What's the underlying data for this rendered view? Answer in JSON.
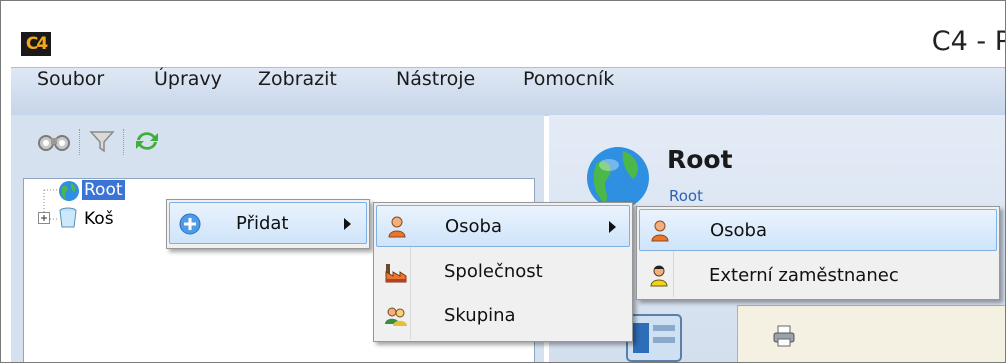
{
  "window": {
    "app_logo": "C4",
    "title": "C4 - P"
  },
  "menubar": [
    "Soubor",
    "Úpravy",
    "Zobrazit",
    "Nástroje",
    "Pomocník"
  ],
  "toolbar": {
    "icons": [
      "binoculars-icon",
      "filter-icon",
      "refresh-icon"
    ]
  },
  "tree": {
    "root": "Root",
    "trash": "Koš"
  },
  "detail": {
    "title": "Root",
    "subtitle": "Root"
  },
  "context_menu": {
    "add": "Přidat"
  },
  "submenu_add": {
    "person": "Osoba",
    "company": "Společnost",
    "group": "Skupina"
  },
  "submenu_person": {
    "person": "Osoba",
    "external": "Externí zaměstnanec"
  },
  "colors": {
    "selection": "#3a74d6",
    "menubar": "#c6d5ea",
    "highlight": "#cfe4fa"
  }
}
